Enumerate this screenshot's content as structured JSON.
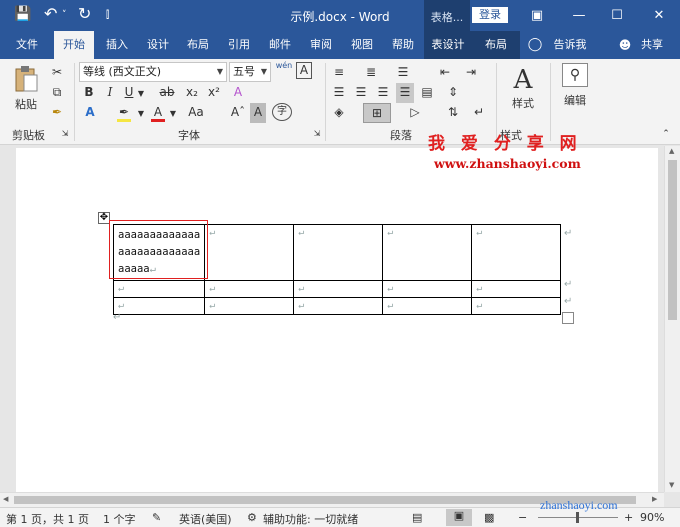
{
  "titlebar": {
    "quick_save": "💾",
    "quick_undo": "↶",
    "quick_undo_arrow": "˅",
    "quick_redo": "↻",
    "quick_custom": "⫿",
    "title": "示例.docx  -  Word",
    "context_label": "表格...",
    "login": "登录",
    "ribbon_display": "▣",
    "minimize": "—",
    "maximize": "☐",
    "close": "✕"
  },
  "tabs": [
    {
      "label": "文件"
    },
    {
      "label": "开始"
    },
    {
      "label": "插入"
    },
    {
      "label": "设计"
    },
    {
      "label": "布局"
    },
    {
      "label": "引用"
    },
    {
      "label": "邮件"
    },
    {
      "label": "审阅"
    },
    {
      "label": "视图"
    },
    {
      "label": "帮助"
    },
    {
      "label": "表设计"
    },
    {
      "label": "布局"
    }
  ],
  "tell_me": "告诉我",
  "share": "共享",
  "ribbon": {
    "clipboard": {
      "paste": "粘贴",
      "group": "剪贴板"
    },
    "font": {
      "name": "等线 (西文正文)",
      "size": "五号",
      "phonetic": "wén",
      "border_char": "A",
      "bold": "B",
      "italic": "I",
      "underline": "U",
      "strike": "ab",
      "sub": "x₂",
      "sup": "x²",
      "clear": "A",
      "effect": "A",
      "font_color": "A",
      "change_case": "Aa",
      "grow": "Aˆ",
      "shrink": "A",
      "group": "字体",
      "highlight_color": "#f5e642",
      "font_color_bar": "#e02020"
    },
    "paragraph": {
      "group": "段落"
    },
    "styles": {
      "label": "样式",
      "group": "样式"
    },
    "editing": {
      "label": "编辑"
    }
  },
  "document": {
    "cell_lines": [
      "aaaaaaaaaaaaa",
      "aaaaaaaaaaaaa",
      "aaaaa"
    ],
    "para_mark": "↵",
    "move_handle": "✥"
  },
  "watermark": {
    "title": "我 爱 分 享 网",
    "url": "www.zhanshaoyi.com",
    "url2": "zhanshaoyi.com"
  },
  "status": {
    "page": "第 1 页，共 1 页",
    "words": "1 个字",
    "language": "英语(美国)",
    "accessibility": "辅助功能: 一切就绪",
    "zoom": "90%"
  }
}
